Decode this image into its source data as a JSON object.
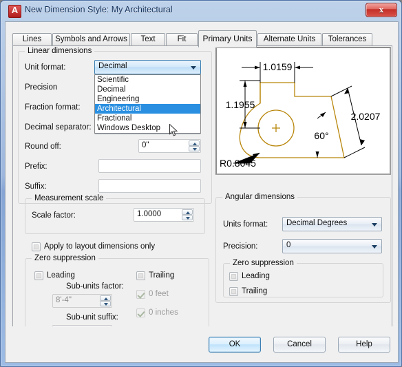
{
  "window": {
    "title": "New Dimension Style: My Architectural",
    "app_icon": "autocad-a-icon",
    "close_label": "x"
  },
  "tabs": [
    {
      "label": "Lines",
      "selected": false
    },
    {
      "label": "Symbols and Arrows",
      "selected": false
    },
    {
      "label": "Text",
      "selected": false
    },
    {
      "label": "Fit",
      "selected": false
    },
    {
      "label": "Primary Units",
      "selected": true
    },
    {
      "label": "Alternate Units",
      "selected": false
    },
    {
      "label": "Tolerances",
      "selected": false
    }
  ],
  "linear_dimensions": {
    "group_label": "Linear dimensions",
    "unit_format": {
      "label": "Unit format:",
      "value": "Decimal",
      "expanded": true,
      "options": [
        "Scientific",
        "Decimal",
        "Engineering",
        "Architectural",
        "Fractional",
        "Windows Desktop"
      ],
      "highlighted": "Architectural"
    },
    "precision": {
      "label": "Precision"
    },
    "fraction_format": {
      "label": "Fraction format:"
    },
    "decimal_separator": {
      "label": "Decimal separator:"
    },
    "round_off": {
      "label": "Round off:",
      "value": "0\""
    },
    "prefix": {
      "label": "Prefix:",
      "value": ""
    },
    "suffix": {
      "label": "Suffix:",
      "value": ""
    }
  },
  "measurement_scale": {
    "group_label": "Measurement scale",
    "scale_factor": {
      "label": "Scale factor:",
      "value": "1.0000"
    },
    "apply_layout_only": {
      "label": "Apply to layout dimensions only",
      "checked": false
    }
  },
  "zero_suppression_linear": {
    "group_label": "Zero suppression",
    "leading": {
      "label": "Leading",
      "checked": false,
      "disabled": false
    },
    "trailing": {
      "label": "Trailing",
      "checked": false,
      "disabled": false
    },
    "sub_units_factor": {
      "label": "Sub-units factor:",
      "value": "8'-4\"",
      "disabled": true
    },
    "sub_unit_suffix": {
      "label": "Sub-unit suffix:",
      "value": "",
      "disabled": false
    },
    "zero_feet": {
      "label": "0 feet",
      "checked": true,
      "disabled": true
    },
    "zero_inches": {
      "label": "0 inches",
      "checked": true,
      "disabled": true
    }
  },
  "angular_dimensions": {
    "group_label": "Angular dimensions",
    "units_format": {
      "label": "Units format:",
      "value": "Decimal Degrees"
    },
    "precision": {
      "label": "Precision:",
      "value": "0"
    },
    "zero_suppression": {
      "group_label": "Zero suppression",
      "leading": {
        "label": "Leading",
        "checked": false
      },
      "trailing": {
        "label": "Trailing",
        "checked": false
      }
    }
  },
  "preview": {
    "name": "dimension-style-preview",
    "geometry_color": "#b8860b",
    "dimensions": {
      "top_horizontal": "1.0159",
      "left_vertical": "1.1955",
      "right_aligned": "2.0207",
      "angle": "60°",
      "radius": "R0.8045"
    }
  },
  "footer": {
    "ok": "OK",
    "cancel": "Cancel",
    "help": "Help"
  }
}
